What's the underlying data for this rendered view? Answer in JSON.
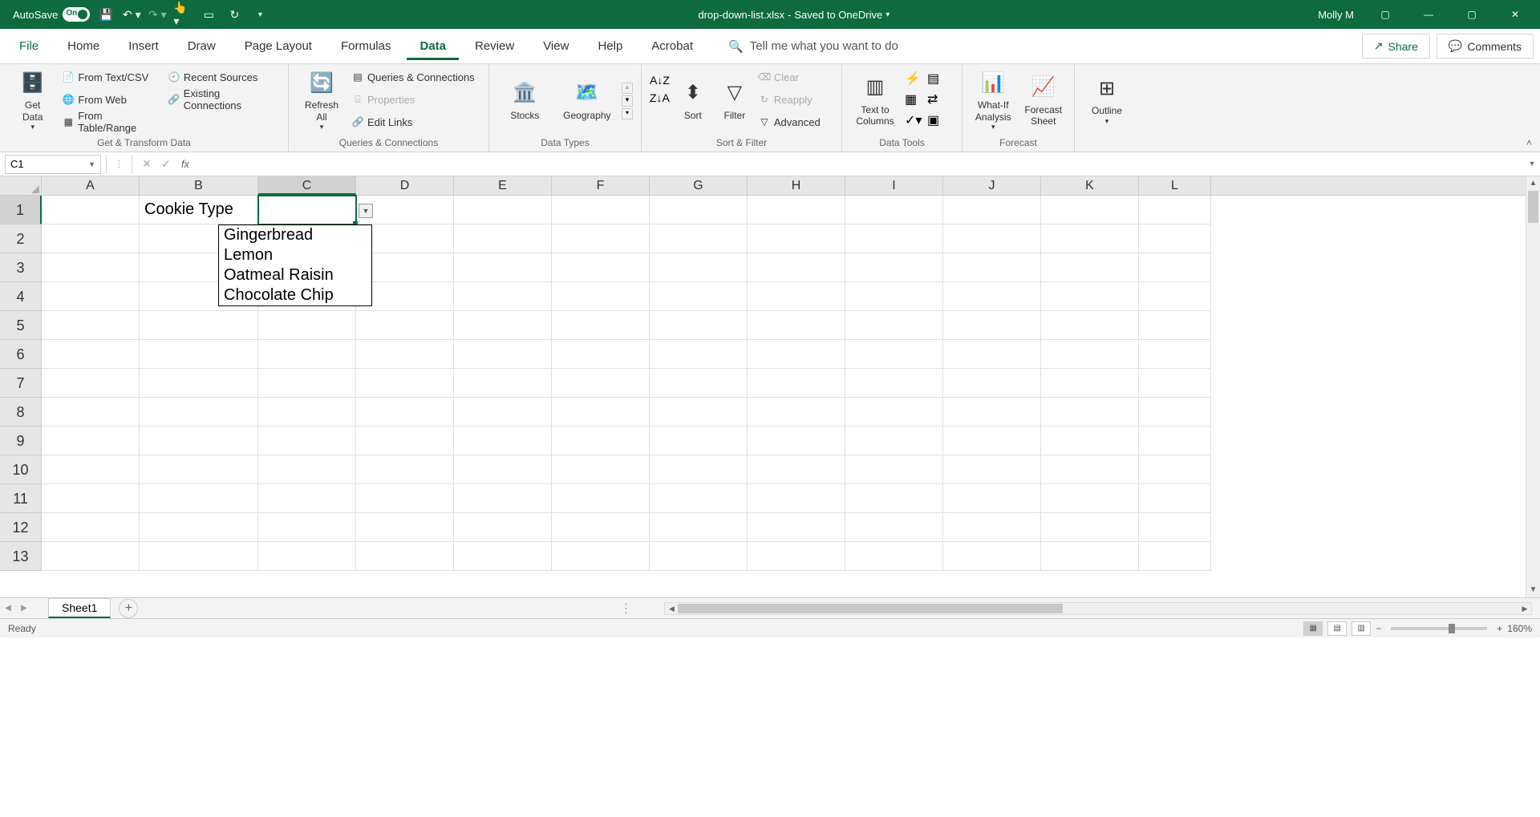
{
  "title_bar": {
    "autosave_label": "AutoSave",
    "autosave_state": "On",
    "filename": "drop-down-list.xlsx",
    "saved_status": "Saved to OneDrive",
    "user": "Molly M"
  },
  "tabs": {
    "file": "File",
    "items": [
      "Home",
      "Insert",
      "Draw",
      "Page Layout",
      "Formulas",
      "Data",
      "Review",
      "View",
      "Help",
      "Acrobat"
    ],
    "active": "Data",
    "tell_me": "Tell me what you want to do",
    "share": "Share",
    "comments": "Comments"
  },
  "ribbon": {
    "get_transform": {
      "label": "Get & Transform Data",
      "get_data": "Get\nData",
      "from_text": "From Text/CSV",
      "from_web": "From Web",
      "from_table": "From Table/Range",
      "recent": "Recent Sources",
      "existing": "Existing Connections"
    },
    "queries": {
      "label": "Queries & Connections",
      "refresh": "Refresh\nAll",
      "queries_conn": "Queries & Connections",
      "properties": "Properties",
      "edit_links": "Edit Links"
    },
    "data_types": {
      "label": "Data Types",
      "stocks": "Stocks",
      "geography": "Geography"
    },
    "sort_filter": {
      "label": "Sort & Filter",
      "sort": "Sort",
      "filter": "Filter",
      "clear": "Clear",
      "reapply": "Reapply",
      "advanced": "Advanced"
    },
    "data_tools": {
      "label": "Data Tools",
      "text_cols": "Text to\nColumns"
    },
    "forecast": {
      "label": "Forecast",
      "whatif": "What-If\nAnalysis",
      "forecast_sheet": "Forecast\nSheet"
    },
    "outline": {
      "label": "",
      "outline": "Outline"
    }
  },
  "formula_bar": {
    "name_box": "C1",
    "formula": ""
  },
  "grid": {
    "columns": [
      "A",
      "B",
      "C",
      "D",
      "E",
      "F",
      "G",
      "H",
      "I",
      "J",
      "K",
      "L"
    ],
    "selected_col": "C",
    "selected_row": 1,
    "row_count": 13,
    "b1": "Cookie Type",
    "dropdown_items": [
      "Gingerbread",
      "Lemon",
      "Oatmeal Raisin",
      "Chocolate Chip"
    ]
  },
  "sheet_tabs": {
    "active": "Sheet1"
  },
  "status_bar": {
    "ready": "Ready",
    "zoom": "160%"
  }
}
